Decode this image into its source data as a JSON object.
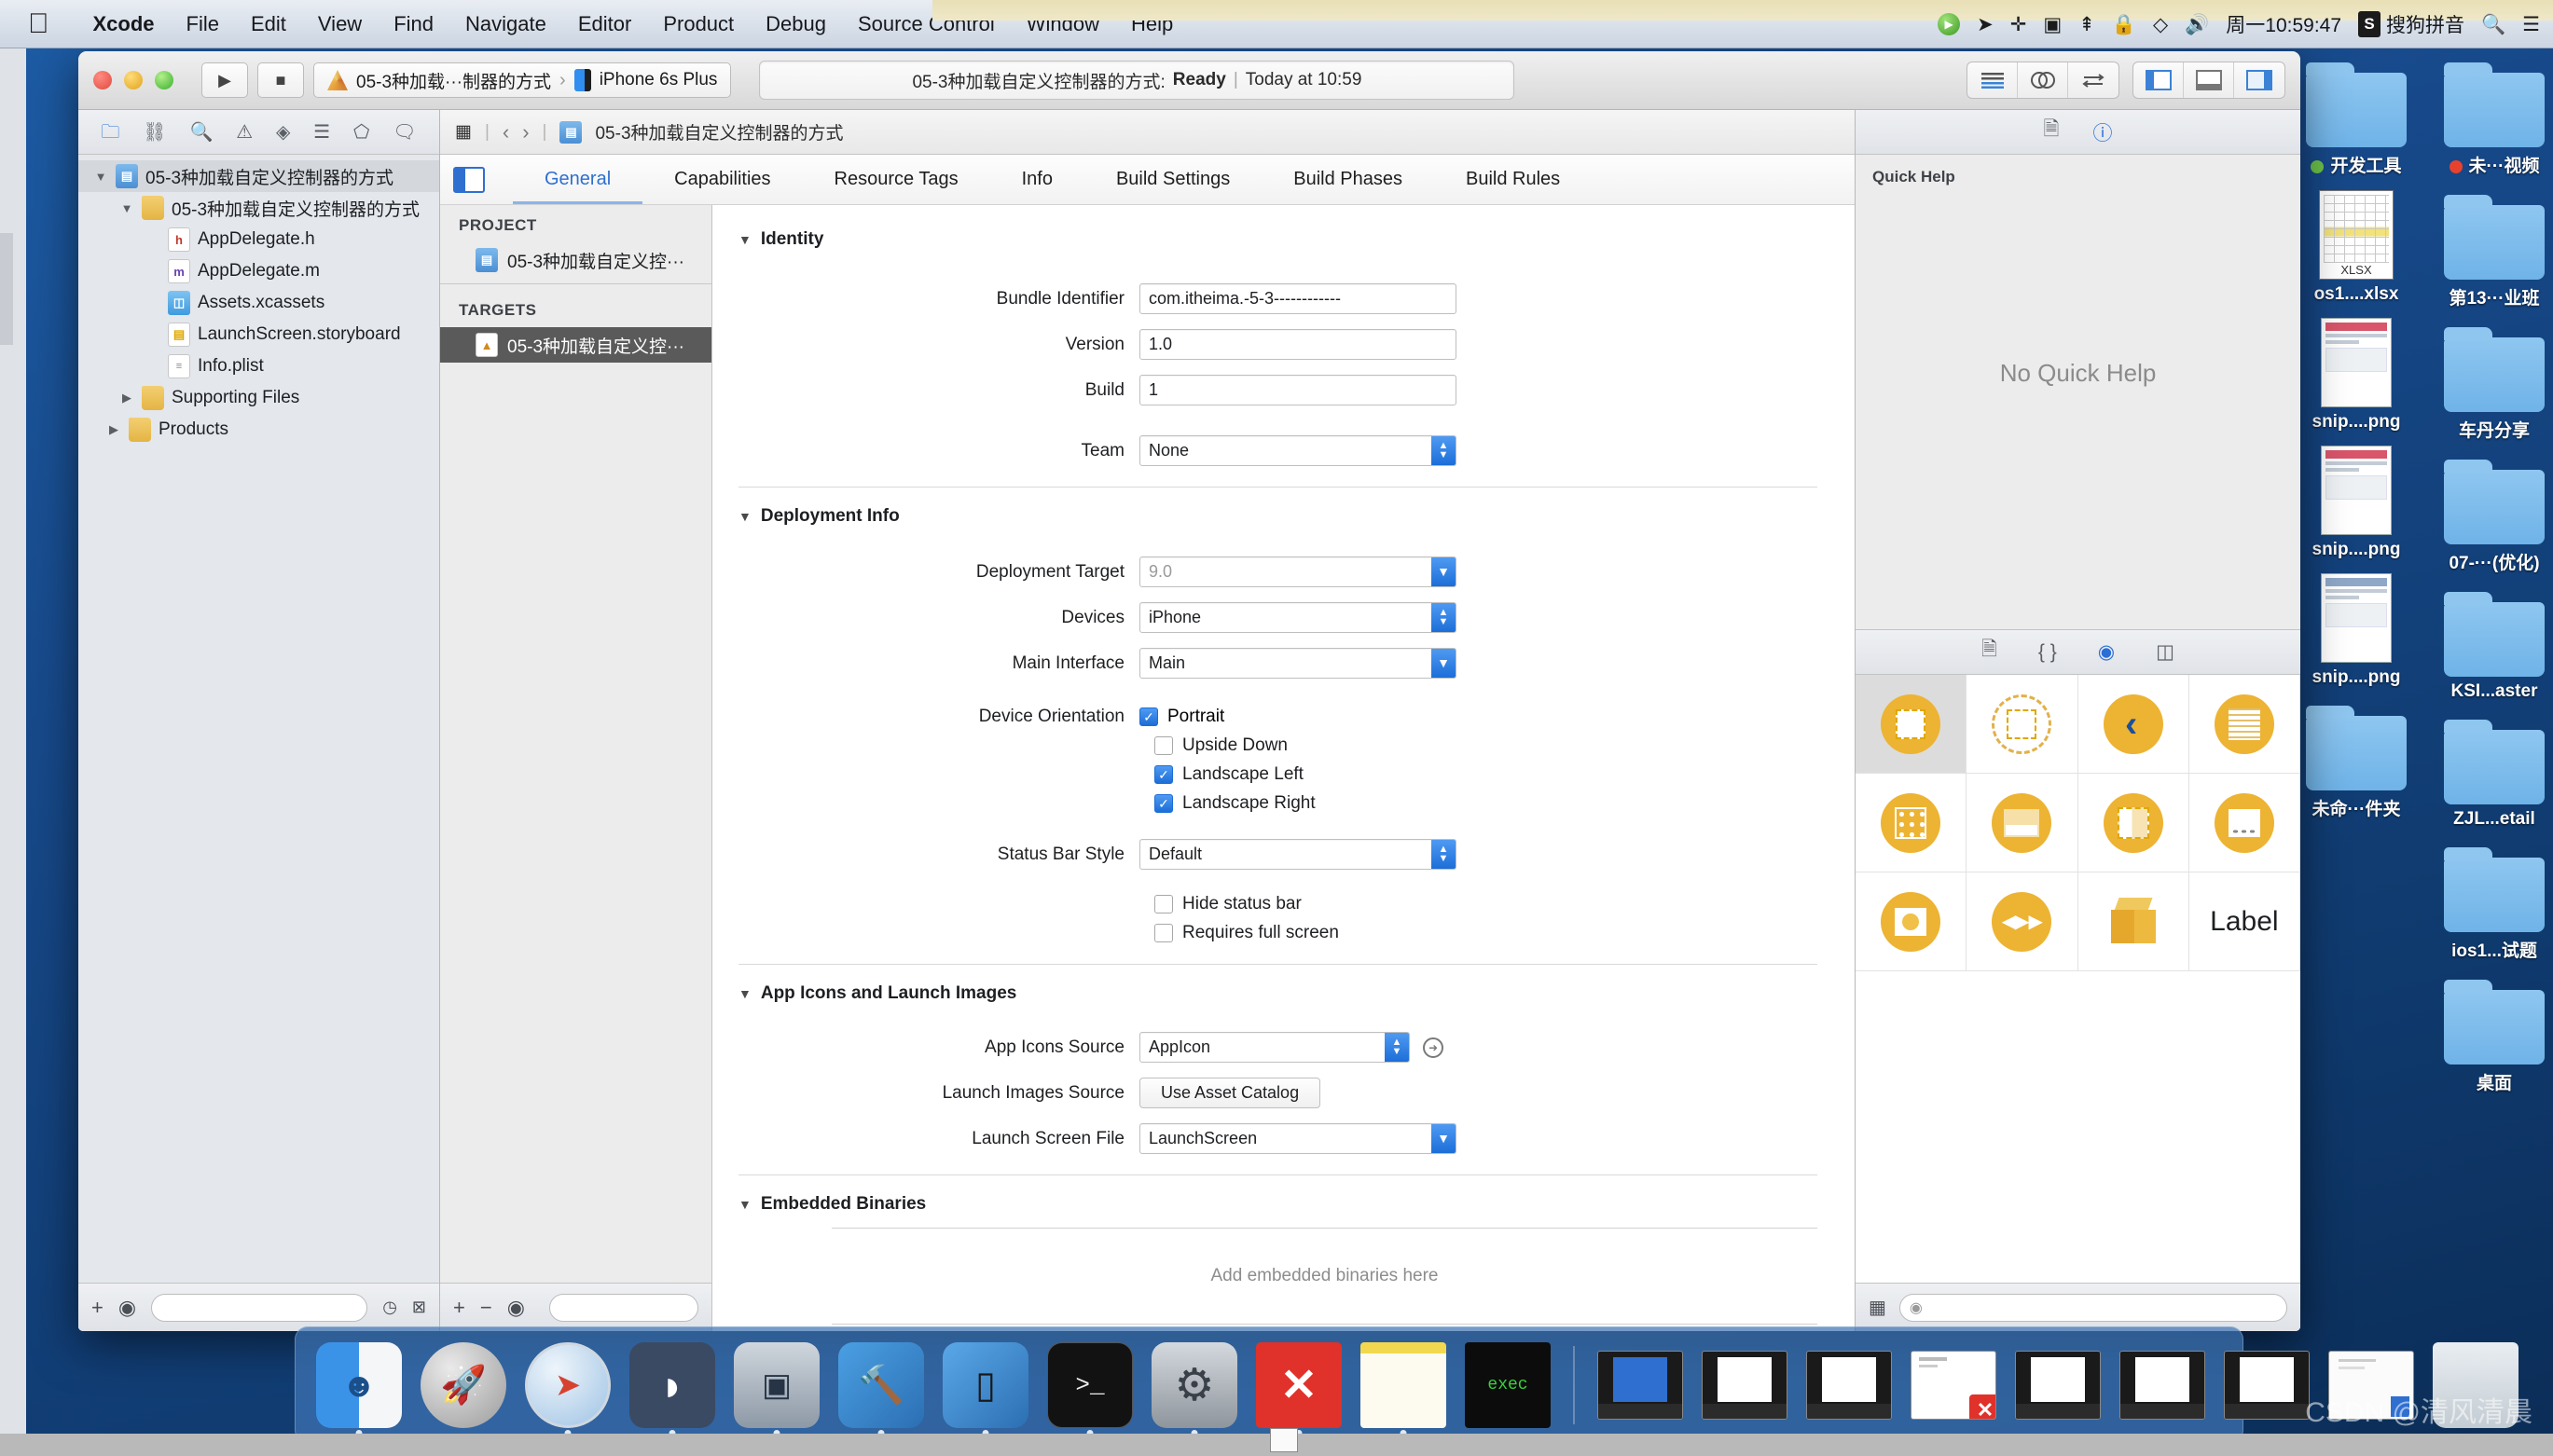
{
  "menubar": {
    "app_name": "Xcode",
    "items": [
      "File",
      "Edit",
      "View",
      "Find",
      "Navigate",
      "Editor",
      "Product",
      "Debug",
      "Source Control",
      "Window",
      "Help"
    ],
    "clock": "周一10:59:47",
    "ime_badge": "S",
    "ime_label": "搜狗拼音",
    "icons": [
      "play-circle-icon",
      "location-icon",
      "bluetooth-icon",
      "screencast-icon",
      "airplay-icon",
      "lock-icon",
      "dropbox-icon",
      "volume-icon"
    ]
  },
  "xcode": {
    "toolbar": {
      "run_label": "▶",
      "stop_label": "■",
      "scheme_name": "05-3种加载···制器的方式",
      "destination": "iPhone 6s Plus",
      "status_project": "05-3种加载自定义控制器的方式:",
      "status_state": "Ready",
      "status_sep": "|",
      "status_time": "Today at 10:59",
      "right_buttons": [
        "editor-standard-icon",
        "editor-assistant-icon",
        "editor-version-icon",
        "view-navigator-icon",
        "view-debug-icon",
        "view-inspector-icon"
      ]
    },
    "navigator": {
      "toolbar_icons": [
        "project-navigator-icon",
        "symbol-navigator-icon",
        "search-navigator-icon",
        "issue-navigator-icon",
        "test-navigator-icon",
        "debug-navigator-icon",
        "breakpoint-navigator-icon",
        "report-navigator-icon"
      ],
      "tree": [
        {
          "label": "05-3种加载自定义控制器的方式",
          "kind": "proj",
          "indent": 0,
          "disc": "▼",
          "selected": true
        },
        {
          "label": "05-3种加载自定义控制器的方式",
          "kind": "folder-s",
          "indent": 1,
          "disc": "▼",
          "selected": false
        },
        {
          "label": "AppDelegate.h",
          "kind": "h",
          "indent": 2,
          "disc": "",
          "selected": false
        },
        {
          "label": "AppDelegate.m",
          "kind": "m",
          "indent": 2,
          "disc": "",
          "selected": false
        },
        {
          "label": "Assets.xcassets",
          "kind": "assets",
          "indent": 2,
          "disc": "",
          "selected": false
        },
        {
          "label": "LaunchScreen.storyboard",
          "kind": "sb",
          "indent": 2,
          "disc": "",
          "selected": false
        },
        {
          "label": "Info.plist",
          "kind": "plist",
          "indent": 2,
          "disc": "",
          "selected": false
        },
        {
          "label": "Supporting Files",
          "kind": "folder-s",
          "indent": 2,
          "disc": "▶",
          "selected": false
        },
        {
          "label": "Products",
          "kind": "folder-s",
          "indent": 1,
          "disc": "▶",
          "selected": false
        }
      ],
      "footer": {
        "add": "+",
        "filter_icon": "filter-icon"
      }
    },
    "jump_bar": {
      "grid_icon": "jump-grid-icon",
      "back": "‹",
      "forward": "›",
      "path_label": "05-3种加载自定义控制器的方式"
    },
    "tabs": [
      {
        "label": "General",
        "active": true
      },
      {
        "label": "Capabilities",
        "active": false
      },
      {
        "label": "Resource Tags",
        "active": false
      },
      {
        "label": "Info",
        "active": false
      },
      {
        "label": "Build Settings",
        "active": false
      },
      {
        "label": "Build Phases",
        "active": false
      },
      {
        "label": "Build Rules",
        "active": false
      }
    ],
    "targets_pane": {
      "project_header": "PROJECT",
      "project_item": "05-3种加载自定义控···",
      "targets_header": "TARGETS",
      "target_item": "05-3种加载自定义控···",
      "footer": {
        "add": "+",
        "remove": "−",
        "filter_icon": "filter-icon"
      }
    },
    "general": {
      "identity": {
        "title": "Identity",
        "bundle_identifier_label": "Bundle Identifier",
        "bundle_identifier_value": "com.itheima.-5-3------------",
        "version_label": "Version",
        "version_value": "1.0",
        "build_label": "Build",
        "build_value": "1",
        "team_label": "Team",
        "team_value": "None"
      },
      "deployment": {
        "title": "Deployment Info",
        "deployment_target_label": "Deployment Target",
        "deployment_target_value": "9.0",
        "devices_label": "Devices",
        "devices_value": "iPhone",
        "main_interface_label": "Main Interface",
        "main_interface_value": "Main",
        "device_orientation_label": "Device Orientation",
        "orientations": [
          {
            "label": "Portrait",
            "checked": true
          },
          {
            "label": "Upside Down",
            "checked": false
          },
          {
            "label": "Landscape Left",
            "checked": true
          },
          {
            "label": "Landscape Right",
            "checked": true
          }
        ],
        "status_bar_style_label": "Status Bar Style",
        "status_bar_style_value": "Default",
        "extra_checks": [
          {
            "label": "Hide status bar",
            "checked": false
          },
          {
            "label": "Requires full screen",
            "checked": false
          }
        ]
      },
      "app_icons": {
        "title": "App Icons and Launch Images",
        "app_icons_source_label": "App Icons Source",
        "app_icons_source_value": "AppIcon",
        "launch_images_source_label": "Launch Images Source",
        "launch_images_source_value": "Use Asset Catalog",
        "launch_screen_file_label": "Launch Screen File",
        "launch_screen_file_value": "LaunchScreen"
      },
      "embedded": {
        "title": "Embedded Binaries",
        "empty_text": "Add embedded binaries here"
      }
    },
    "inspector": {
      "toolbar_icons": [
        "file-inspector-icon",
        "quick-help-icon"
      ],
      "quick_help_title": "Quick Help",
      "quick_help_body": "No Quick Help",
      "library_toolbar_icons": [
        "file-template-library-icon",
        "code-snippet-library-icon",
        "object-library-icon",
        "media-library-icon"
      ],
      "objects": [
        {
          "name": "view-controller",
          "selected": true
        },
        {
          "name": "storyboard-reference",
          "selected": false
        },
        {
          "name": "navigation-controller",
          "selected": false
        },
        {
          "name": "table-view-controller",
          "selected": false
        },
        {
          "name": "collection-view-controller",
          "selected": false
        },
        {
          "name": "tab-bar-controller",
          "selected": false
        },
        {
          "name": "split-view-controller",
          "selected": false
        },
        {
          "name": "page-view-controller",
          "selected": false
        },
        {
          "name": "image-view-controller",
          "selected": false
        },
        {
          "name": "avkit-player-controller",
          "selected": false
        },
        {
          "name": "object",
          "selected": false
        },
        {
          "name": "label",
          "selected": false,
          "text": "Label"
        }
      ],
      "object_label_text": "Label",
      "filter_placeholder": ""
    }
  },
  "desktop": {
    "icons": [
      {
        "label": "开发工具",
        "type": "folder",
        "tag": "#6cc24a",
        "col": 0,
        "row": 0
      },
      {
        "label": "未···视频",
        "type": "folder",
        "tag": "#e8422e",
        "col": 1,
        "row": 0
      },
      {
        "label": "os1....xlsx",
        "type": "xlsx",
        "tag": "",
        "col": 0,
        "row": 1
      },
      {
        "label": "第13···业班",
        "type": "folder",
        "tag": "",
        "col": 1,
        "row": 1
      },
      {
        "label": "snip....png",
        "type": "png",
        "tag": "",
        "col": 0,
        "row": 2
      },
      {
        "label": "车丹分享",
        "type": "folder",
        "tag": "",
        "col": 1,
        "row": 2
      },
      {
        "label": "snip....png",
        "type": "png",
        "tag": "",
        "col": 0,
        "row": 3
      },
      {
        "label": "07-···(优化)",
        "type": "folder",
        "tag": "",
        "col": 1,
        "row": 3
      },
      {
        "label": "snip....png",
        "type": "png",
        "tag": "",
        "col": 0,
        "row": 4
      },
      {
        "label": "KSI...aster",
        "type": "folder",
        "tag": "",
        "col": 1,
        "row": 4
      },
      {
        "label": "未命···件夹",
        "type": "folder",
        "tag": "",
        "col": 0,
        "row": 5
      },
      {
        "label": "ZJL...etail",
        "type": "folder",
        "tag": "",
        "col": 1,
        "row": 5
      },
      {
        "label": "ios1...试题",
        "type": "folder",
        "tag": "",
        "col": 1,
        "row": 6
      },
      {
        "label": "桌面",
        "type": "folder",
        "tag": "",
        "col": 1,
        "row": 7
      }
    ]
  },
  "dock": {
    "apps": [
      {
        "name": "finder-icon",
        "glyph": "◻"
      },
      {
        "name": "launchpad-icon",
        "glyph": "🚀"
      },
      {
        "name": "safari-icon",
        "glyph": "◎"
      },
      {
        "name": "browser-icon",
        "glyph": "◗"
      },
      {
        "name": "quicktime-icon",
        "glyph": "▣"
      },
      {
        "name": "xcode-icon",
        "glyph": "🔨"
      },
      {
        "name": "simulator-icon",
        "glyph": "▯"
      },
      {
        "name": "terminal-icon",
        "glyph": ">_"
      },
      {
        "name": "system-preferences-icon",
        "glyph": "⚙"
      },
      {
        "name": "xmind-icon",
        "glyph": "✕"
      },
      {
        "name": "notes-icon",
        "glyph": "▤"
      },
      {
        "name": "exec-icon",
        "glyph": "exec"
      }
    ],
    "windows": [
      {
        "name": "window-thumb-1"
      },
      {
        "name": "window-thumb-2"
      },
      {
        "name": "window-thumb-3"
      },
      {
        "name": "xmind-doc-thumb"
      },
      {
        "name": "window-thumb-4"
      },
      {
        "name": "window-thumb-5"
      },
      {
        "name": "window-thumb-6"
      },
      {
        "name": "document-thumb"
      }
    ],
    "trash": {
      "name": "trash-icon"
    }
  },
  "watermark": "CSDN @清风清晨"
}
